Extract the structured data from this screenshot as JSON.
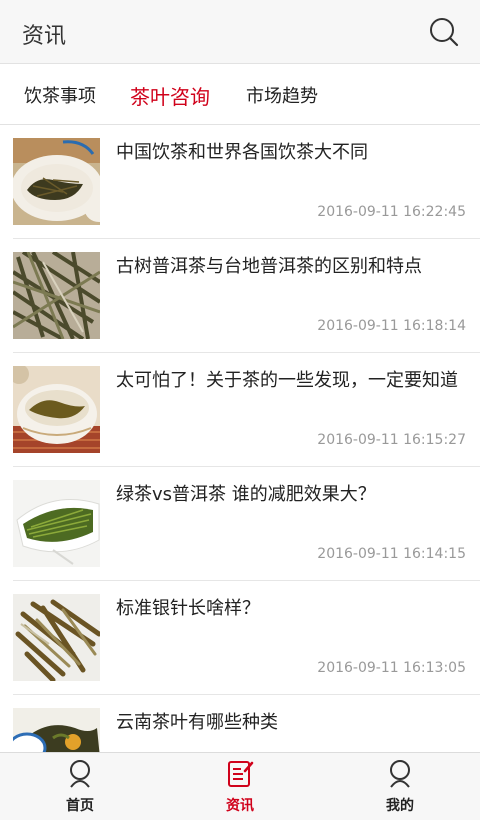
{
  "header": {
    "title": "资讯"
  },
  "tabs": [
    {
      "label": "饮茶事项"
    },
    {
      "label": "茶叶咨询"
    },
    {
      "label": "市场趋势"
    }
  ],
  "articles": [
    {
      "title": "中国饮茶和世界各国饮茶大不同",
      "time": "2016-09-11 16:22:45"
    },
    {
      "title": "古树普洱茶与台地普洱茶的区别和特点",
      "time": "2016-09-11 16:18:14"
    },
    {
      "title": "太可怕了！关于茶的一些发现，一定要知道",
      "time": "2016-09-11 16:15:27"
    },
    {
      "title": "绿茶vs普洱茶 谁的减肥效果大？",
      "time": "2016-09-11 16:14:15"
    },
    {
      "title": "标准银针长啥样？",
      "time": "2016-09-11 16:13:05"
    },
    {
      "title": "云南茶叶有哪些种类",
      "time": ""
    }
  ],
  "bottom_nav": [
    {
      "label": "首页",
      "icon": "person-icon"
    },
    {
      "label": "资讯",
      "icon": "news-icon"
    },
    {
      "label": "我的",
      "icon": "person-icon"
    }
  ],
  "colors": {
    "accent": "#d0021b",
    "bar_bg": "#f7f7f7"
  }
}
